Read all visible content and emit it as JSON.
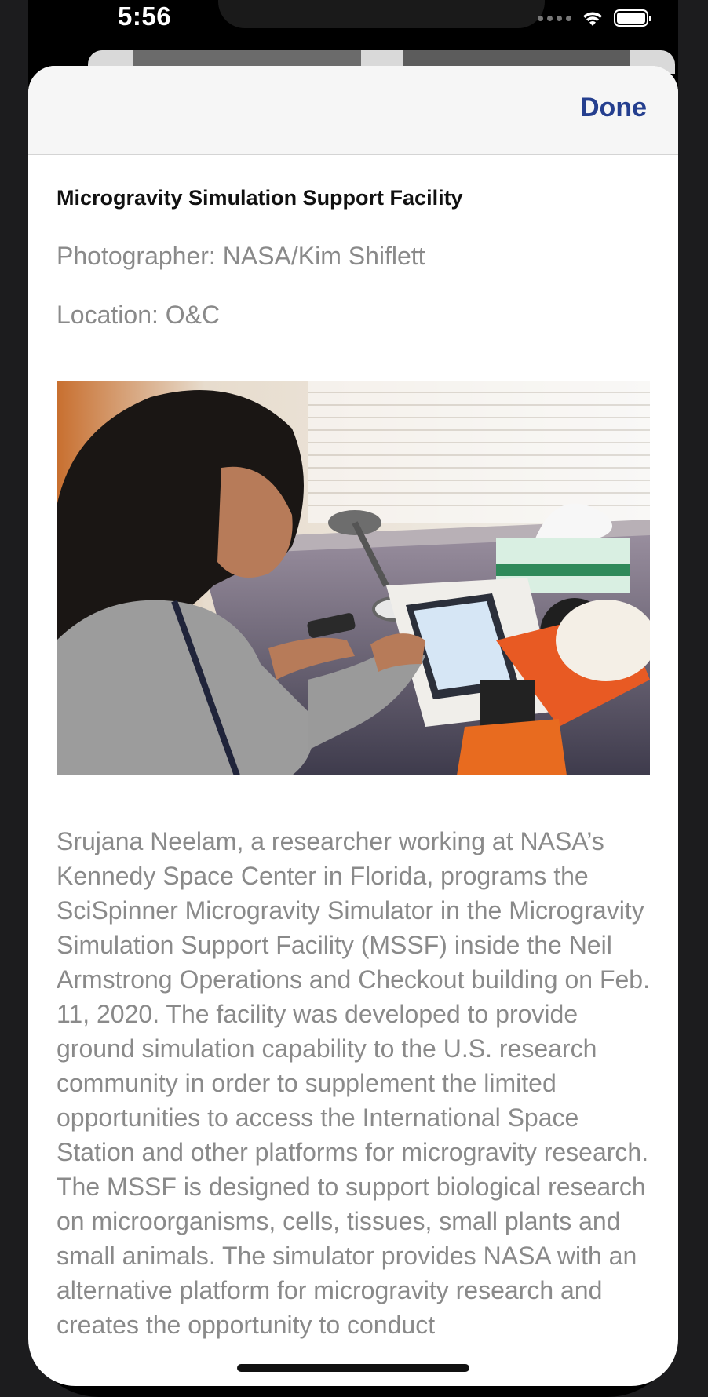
{
  "status_bar": {
    "time": "5:56"
  },
  "nav": {
    "done_label": "Done"
  },
  "detail": {
    "title": "Microgravity Simulation Support Facility",
    "photographer": "Photographer: NASA/Kim Shiflett",
    "location": "Location: O&C",
    "description": "Srujana Neelam, a researcher working at NASA’s Kennedy Space Center in Florida, programs the SciSpinner Microgravity Simulator in the Microgravity Simulation Support Facility (MSSF) inside the Neil Armstrong Operations and Checkout building on Feb. 11, 2020. The facility was developed to provide ground simulation capability to the U.S. research community in order to supplement the limited opportunities to access the International Space Station and other platforms for microgravity research. The MSSF is designed to support biological research on microorganisms, cells, tissues, small plants and small animals. The simulator provides NASA with an alternative platform for microgravity research and creates the opportunity to conduct"
  },
  "colors": {
    "accent": "#253f8f",
    "secondary_text": "#8a8a8a",
    "navbar_bg": "#f6f6f6"
  },
  "icons": [
    "signal-dots-icon",
    "wifi-icon",
    "battery-icon"
  ]
}
